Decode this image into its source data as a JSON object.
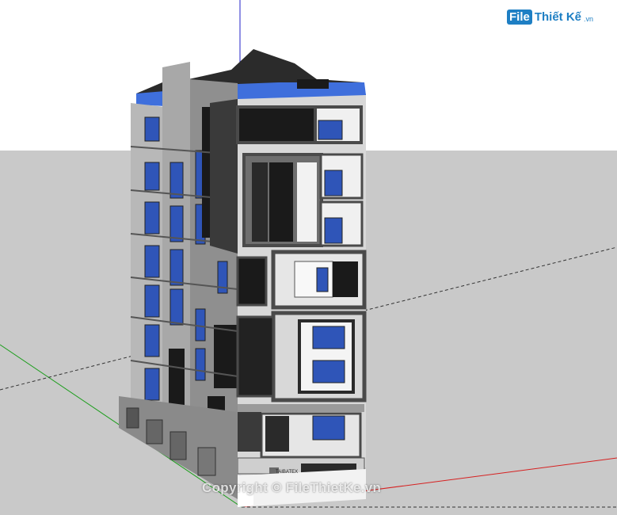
{
  "viewport": {
    "sky_color": "#ffffff",
    "ground_color": "#c9c9c9",
    "axis_colors": {
      "red": "#d62020",
      "green": "#1e9e1e",
      "blue": "#2020c8"
    }
  },
  "model": {
    "name": "building-model",
    "sign_text": "TAIBATEX",
    "glass_color": "#3f6fdc",
    "wall_color": "#cfcfcf",
    "frame_color": "#4a4a4a",
    "void_color": "#1a1a1a"
  },
  "branding": {
    "logo_box": "File",
    "logo_text": "Thiết Kế",
    "logo_sub": ".vn",
    "watermark": "Copyright © FileThietKe.vn"
  }
}
